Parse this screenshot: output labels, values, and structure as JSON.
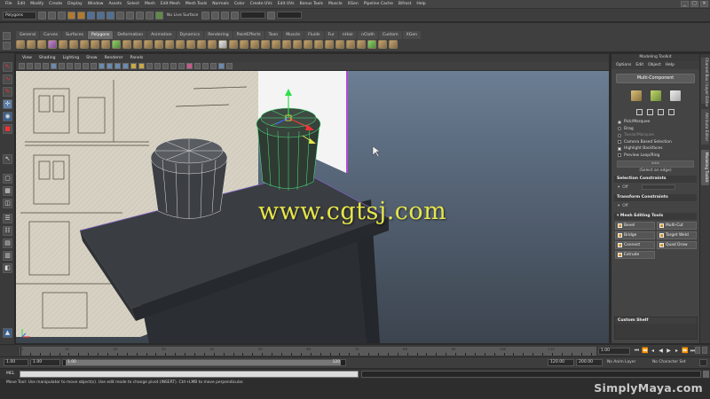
{
  "menubar": {
    "items": [
      "File",
      "Edit",
      "Modify",
      "Create",
      "Display",
      "Window",
      "Assets",
      "Select",
      "Mesh",
      "Edit Mesh",
      "Mesh Tools",
      "Normals",
      "Color",
      "Create UVs",
      "Edit UVs",
      "Bonus Tools",
      "Muscle",
      "XGen",
      "Pipeline Cache",
      "Bifrost",
      "Help"
    ]
  },
  "status_line": {
    "mode": "Polygons",
    "snap_label": "No Live Surface"
  },
  "shelf": {
    "tabs": [
      "General",
      "Curves",
      "Surfaces",
      "Polygons",
      "Deformation",
      "Animation",
      "Dynamics",
      "Rendering",
      "PaintEffects",
      "Toon",
      "Muscle",
      "Fluids",
      "Fur",
      "nHair",
      "nCloth",
      "Custom",
      "XGen"
    ],
    "active_tab": "Polygons"
  },
  "viewport": {
    "menu": [
      "View",
      "Shading",
      "Lighting",
      "Show",
      "Renderer",
      "Panels"
    ],
    "watermark": "www.cgtsj.com"
  },
  "modeling_toolkit": {
    "title": "Modeling Toolkit",
    "menu": [
      "Options",
      "Edit",
      "Object",
      "Help"
    ],
    "multi_component": "Multi-Component",
    "options": [
      {
        "label": "Pick/Marquee",
        "type": "radio",
        "on": true
      },
      {
        "label": "Drag",
        "type": "radio",
        "on": false
      },
      {
        "label": "Tweak/Marquee",
        "type": "radio",
        "on": false,
        "dim": true
      },
      {
        "label": "Camera Based Selection",
        "type": "check",
        "on": false
      },
      {
        "label": "Highlight Backfaces",
        "type": "check",
        "on": true
      },
      {
        "label": "Preview Loop/Ring",
        "type": "check",
        "on": false
      }
    ],
    "select_note": "(Select an edge)",
    "selection_constraints": "Selection Constraints",
    "selection_constraints_value": "Off",
    "transform_constraints": "Transform Constraints",
    "transform_constraints_value": "Off",
    "mesh_editing_tools": "Mesh Editing Tools",
    "mesh_tools": [
      "Bevel",
      "Multi-Cut",
      "Bridge",
      "Target Weld",
      "Connect",
      "Quad Draw",
      "Extrude"
    ],
    "custom_shelf": "Custom Shelf"
  },
  "side_tabs": [
    "Channel Box / Layer Editor",
    "Attribute Editor",
    "Modeling Toolkit"
  ],
  "timeline": {
    "ticks": [
      1,
      10,
      20,
      30,
      40,
      50,
      60,
      70,
      80,
      90,
      100,
      110,
      120
    ],
    "current_time": "1.00"
  },
  "range": {
    "start": "1.00",
    "playback_start": "1.00",
    "slider_left": "1.00",
    "slider_right": "120",
    "playback_end": "120.00",
    "end": "200.00",
    "anim_layer": "No Anim Layer",
    "character_set": "No Character Set"
  },
  "command_line": {
    "label": "MEL"
  },
  "help_line": {
    "text": "Move Tool: Use manipulator to move object(s). Use edit mode to change pivot (INSERT). Ctrl+LMB to move perpendicular."
  },
  "brand": "SimplyMaya.com"
}
